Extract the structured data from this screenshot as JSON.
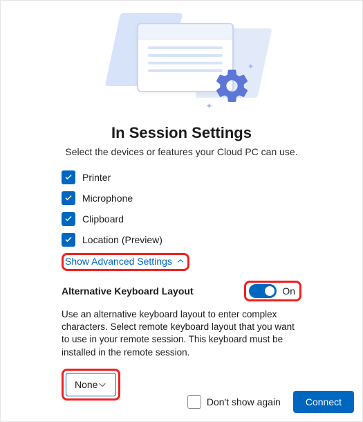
{
  "title": "In Session Settings",
  "subtitle": "Select the devices or features your Cloud PC can use.",
  "devices": {
    "printer": "Printer",
    "microphone": "Microphone",
    "clipboard": "Clipboard",
    "location": "Location (Preview)"
  },
  "advanced_link": "Show Advanced Settings",
  "alt_keyboard": {
    "heading": "Alternative Keyboard Layout",
    "toggle_state": "On",
    "description": "Use an alternative keyboard layout to enter complex characters. Select remote keyboard layout that you want to use in your remote session. This keyboard must be installed in the remote session.",
    "selected": "None"
  },
  "footer": {
    "dont_show": "Don't show again",
    "connect": "Connect"
  }
}
